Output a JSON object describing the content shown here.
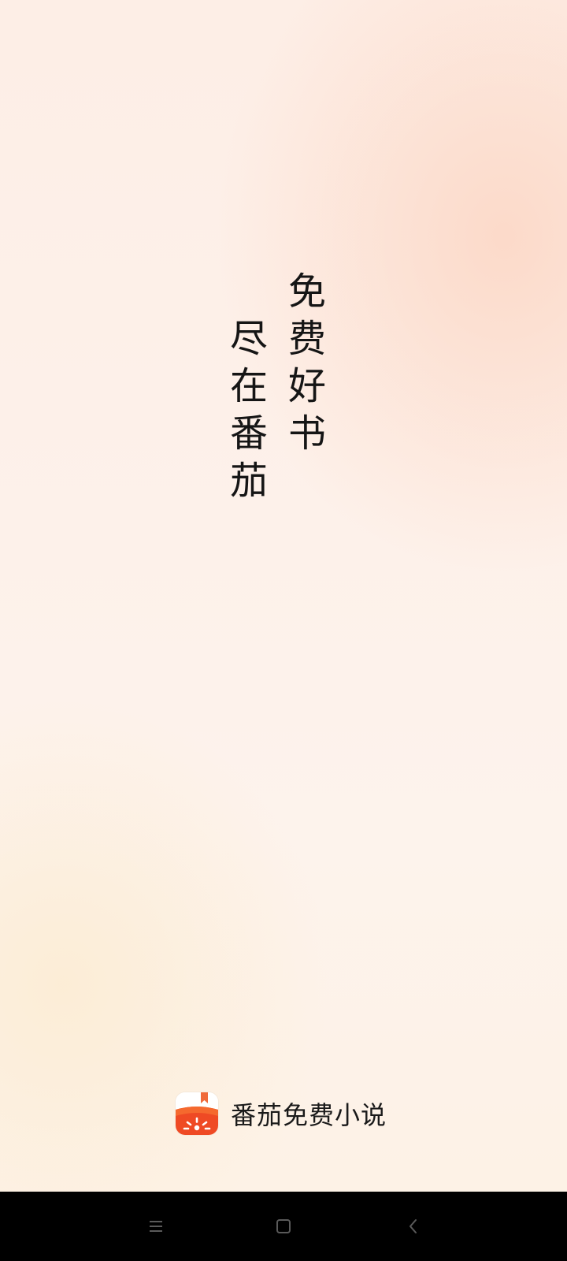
{
  "slogan": {
    "right_column": [
      "免",
      "费",
      "好",
      "书"
    ],
    "left_column": [
      "尽",
      "在",
      "番",
      "茄"
    ]
  },
  "brand": {
    "app_name": "番茄免费小说",
    "icon": "tomato-app-icon",
    "colors": {
      "tomato_red": "#ef4a24",
      "tomato_orange": "#f5692e",
      "bookmark": "#f06a3a"
    }
  },
  "navbar": {
    "buttons": [
      {
        "name": "menu",
        "icon": "menu-icon"
      },
      {
        "name": "home",
        "icon": "square-icon"
      },
      {
        "name": "back",
        "icon": "chevron-left-icon"
      }
    ],
    "icon_color": "#5a5a5a"
  }
}
